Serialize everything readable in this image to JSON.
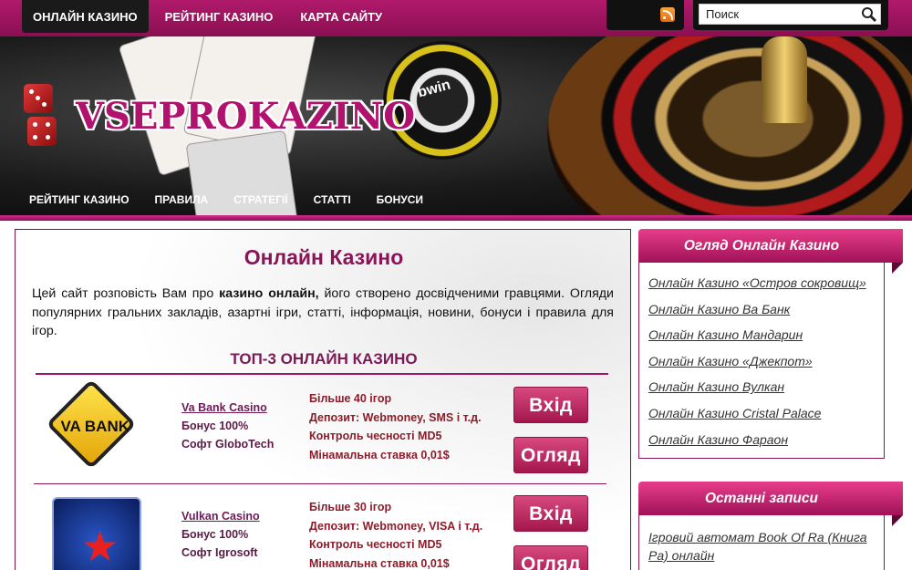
{
  "topnav": [
    {
      "label": "ОНЛАЙН КАЗИНО",
      "active": true
    },
    {
      "label": "РЕЙТИНГ КАЗИНО",
      "active": false
    },
    {
      "label": "КАРТА САЙТУ",
      "active": false
    }
  ],
  "search": {
    "placeholder": "Поиск"
  },
  "header": {
    "logo_text": "VSEPROKAZINO",
    "chip_text": "bwin"
  },
  "subnav": [
    "РЕЙТИНГ КАЗИНО",
    "ПРАВИЛА",
    "СТРАТЕГІЇ",
    "СТАТТІ",
    "БОНУСИ"
  ],
  "main": {
    "title": "Онлайн Казино",
    "intro_pre": "Цей сайт розповість Вам про ",
    "intro_bold": "казино онлайн,",
    "intro_post": " його створено досвідченими гравцями. Огляди популярних гральних закладів, азартні ігри, статті, інформація, новини, бонуси і правила для ігор.",
    "top3_heading": "ТОП-3 ОНЛАЙН КАЗИНО",
    "casinos": [
      {
        "logo_text": "VA BANK",
        "name": "Va Bank Casino",
        "bonus": "Бонус 100%",
        "soft": "Софт GloboTech",
        "features": [
          "Більше 40 ігор",
          "Депозит: Webmoney, SMS і т.д.",
          "Контроль чесності MD5",
          "Мінамальна ставка 0,01$"
        ],
        "btn_enter": "Вхід",
        "btn_review": "Огляд"
      },
      {
        "logo_text": "",
        "name": "Vulkan Casino",
        "bonus": "Бонус 100%",
        "soft": "Софт Igrosoft",
        "features": [
          "Більше 30 ігор",
          "Депозит: Webmoney, VISA і т.д.",
          "Контроль чесності MD5",
          "Мінамальна ставка 0,01$"
        ],
        "btn_enter": "Вхід",
        "btn_review": "Огляд"
      }
    ]
  },
  "sidebar": {
    "review_title": "Огляд Онлайн Казино",
    "review_links": [
      "Онлайн Казино «Остров сокровищ»",
      "Онлайн Казино Ва Банк",
      "Онлайн Казино Мандарин",
      "Онлайн Казино «Джекпот»",
      "Онлайн Казино Вулкан",
      "Онлайн Казино Cristal Palace",
      "Онлайн Казино Фараон"
    ],
    "recent_title": "Останні записи",
    "recent_links": [
      "Ігровий автомат Book Of Ra (Книга Ра) онлайн"
    ]
  },
  "colors": {
    "brand": "#a01258",
    "accent": "#8a1458",
    "topbar": "#b01a6b"
  }
}
